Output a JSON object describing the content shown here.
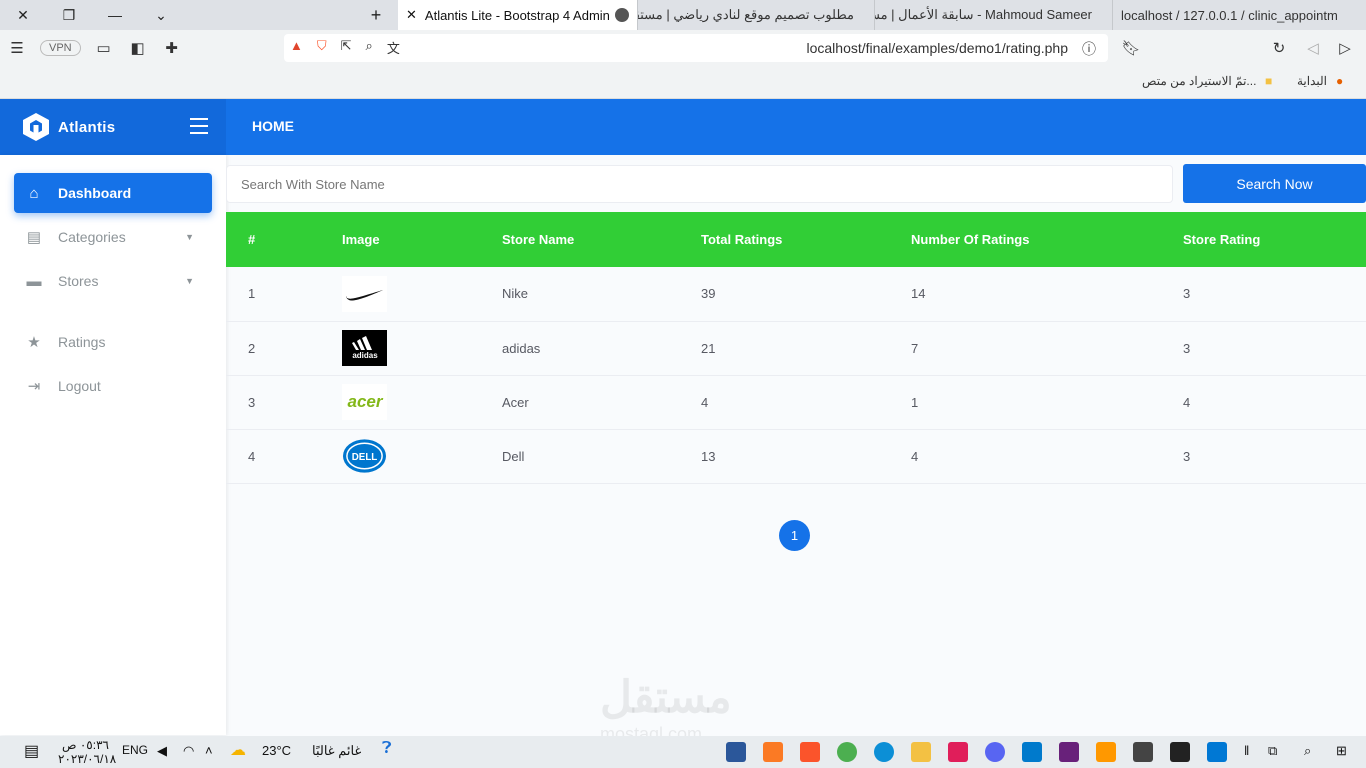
{
  "browser": {
    "tabs": [
      {
        "label": "Atlantis Lite - Bootstrap 4 Admin",
        "active": true
      },
      {
        "label": "مطلوب تصميم موقع لنادي رياضي | مستقل",
        "active": false
      },
      {
        "label": "Mahmoud Sameer - سابقة الأعمال | مستقل",
        "active": false
      },
      {
        "label": "localhost / 127.0.0.1 / clinic_appointm",
        "active": false
      }
    ],
    "url": "localhost/final/examples/demo1/rating.php",
    "vpn_label": "VPN",
    "bookmarks": [
      {
        "label": "البداية"
      },
      {
        "label": "تمّ الاستيراد من متص..."
      }
    ]
  },
  "app": {
    "brand": "Atlantis",
    "topnav_home": "HOME",
    "sidebar": [
      {
        "label": "Dashboard",
        "icon": "home-icon",
        "active": true
      },
      {
        "label": "Categories",
        "icon": "table-icon",
        "has_caret": true
      },
      {
        "label": "Stores",
        "icon": "store-icon",
        "has_caret": true
      },
      {
        "label": "Ratings",
        "icon": "star-icon"
      },
      {
        "label": "Logout",
        "icon": "logout-icon"
      }
    ],
    "search": {
      "placeholder": "Search With Store Name",
      "button": "Search Now"
    },
    "table": {
      "headers": [
        "#",
        "Image",
        "Store Name",
        "Total Ratings",
        "Number Of Ratings",
        "Store Rating"
      ],
      "rows": [
        {
          "id": "1",
          "logo": "nike-logo",
          "name": "Nike",
          "total": "39",
          "count": "14",
          "rating": "3"
        },
        {
          "id": "2",
          "logo": "adidas-logo",
          "name": "adidas",
          "total": "21",
          "count": "7",
          "rating": "3"
        },
        {
          "id": "3",
          "logo": "acer-logo",
          "name": "Acer",
          "total": "4",
          "count": "1",
          "rating": "4"
        },
        {
          "id": "4",
          "logo": "dell-logo",
          "name": "Dell",
          "total": "13",
          "count": "4",
          "rating": "3"
        }
      ]
    },
    "pagination": {
      "current": "1"
    }
  },
  "taskbar": {
    "time": "٠٥:٣٦ ص",
    "date": "٢٠٢٣/٠٦/١٨",
    "lang": "ENG",
    "temp": "23°C",
    "weather": "غائم غالبًا"
  },
  "watermark": {
    "main": "مستقل",
    "sub": "mostaql.com"
  },
  "colors": {
    "primary": "#1572e8",
    "brand": "#1269db",
    "header_green": "#31ce36"
  }
}
